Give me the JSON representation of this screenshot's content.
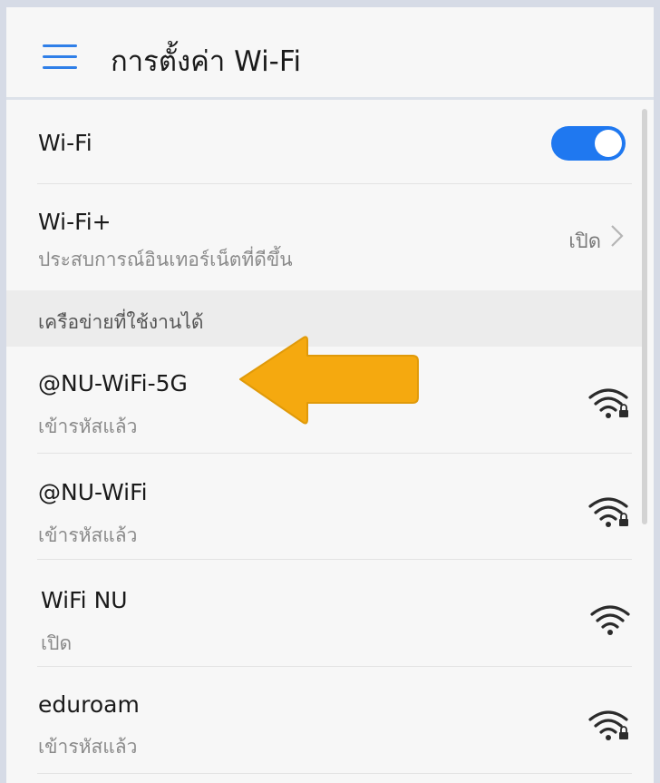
{
  "header": {
    "title": "การตั้งค่า Wi-Fi",
    "menu_icon": "hamburger-menu-icon"
  },
  "wifi_toggle": {
    "label": "Wi-Fi",
    "enabled": true,
    "accent_color": "#1f78f0"
  },
  "wifi_plus": {
    "title": "Wi-Fi+",
    "subtitle": "ประสบการณ์อินเทอร์เน็ตที่ดีขึ้น",
    "status": "เปิด"
  },
  "networks_section": {
    "label": "เครือข่ายที่ใช้งานได้"
  },
  "networks": [
    {
      "name": "@NU-WiFi-5G",
      "status": "เข้ารหัสแล้ว",
      "secured": true,
      "icon": "wifi-lock-icon"
    },
    {
      "name": "@NU-WiFi",
      "status": "เข้ารหัสแล้ว",
      "secured": true,
      "icon": "wifi-lock-icon"
    },
    {
      "name": "WiFi NU",
      "status": "เปิด",
      "secured": false,
      "icon": "wifi-icon"
    },
    {
      "name": "eduroam",
      "status": "เข้ารหัสแล้ว",
      "secured": true,
      "icon": "wifi-lock-icon"
    }
  ],
  "annotation": {
    "arrow_color": "#f5a90f",
    "points_to": "@NU-WiFi-5G"
  }
}
